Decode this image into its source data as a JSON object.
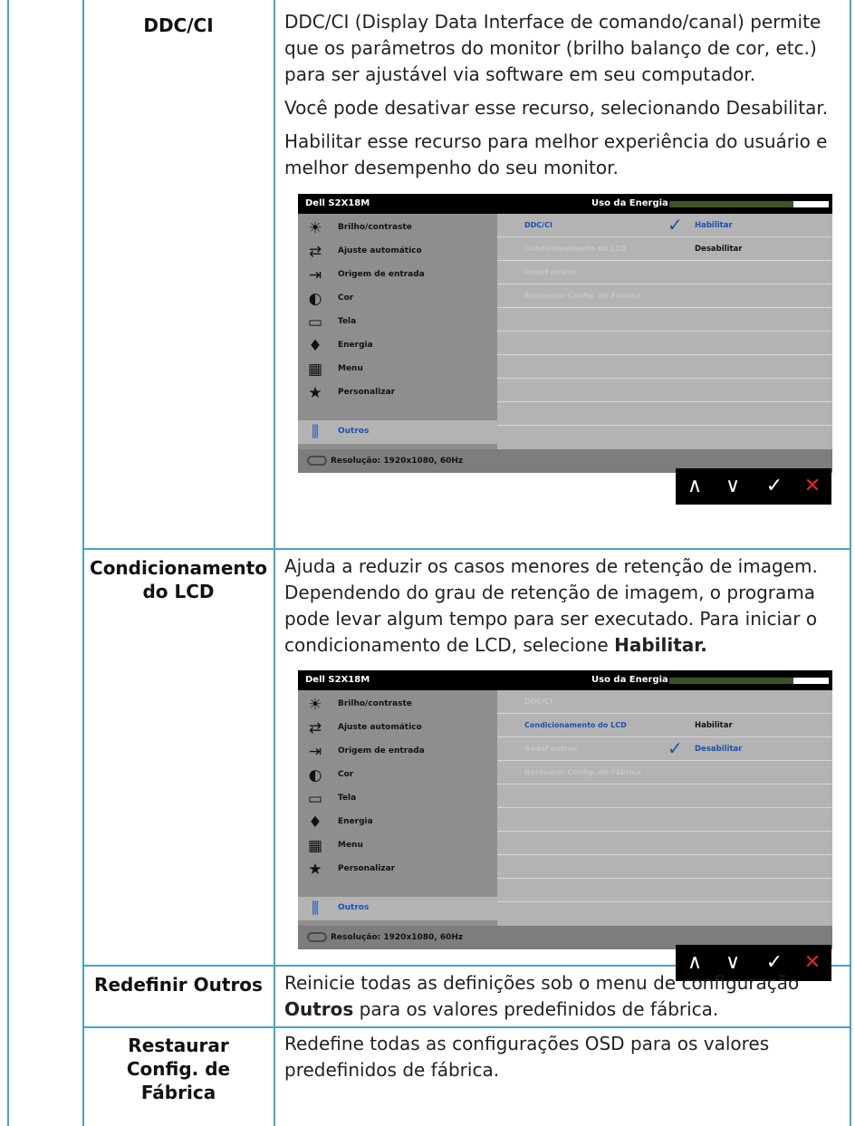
{
  "rows": [
    {
      "term": "DDC/CI",
      "paragraphs": [
        "DDC/CI (Display Data Interface de comando/canal) permite que os parâmetros do monitor (brilho balanço de cor, etc.) para ser ajustável via software em seu computador.",
        "Você pode desativar esse recurso, selecionando Desabilitar.",
        "Habilitar esse recurso para melhor experiência do usuário e melhor desempenho do seu monitor."
      ]
    },
    {
      "term_line1": "Condicionamento",
      "term_line2": "do LCD",
      "text_before": "Ajuda a reduzir os casos menores de retenção de imagem. Dependendo do grau de retenção de imagem, o programa pode levar algum tempo para ser executado. Para iniciar o condicionamento de LCD, selecione ",
      "text_bold": "Habilitar.",
      "text_after": ""
    },
    {
      "term": "Redefinir Outros",
      "text_before": "Reinicie todas as definições sob o menu de configuração ",
      "text_bold": "Outros",
      "text_after": " para os valores predefinidos de fábrica."
    },
    {
      "term_line1": "Restaurar",
      "term_line2": "Config. de",
      "term_line3": "Fábrica",
      "text": "Redefine todas as configurações OSD para os valores predefinidos de fábrica."
    }
  ],
  "osd": {
    "model": "Dell S2X18M",
    "energy_label": "Uso da Energia",
    "energy_level": 0.78,
    "resolution": "Resolução: 1920x1080, 60Hz",
    "menu": [
      {
        "icon": "brightness-icon",
        "glyph": "☀",
        "label": "Brilho/contraste"
      },
      {
        "icon": "auto-adjust-icon",
        "glyph": "⇄",
        "label": "Ajuste automático"
      },
      {
        "icon": "input-source-icon",
        "glyph": "⇥",
        "label": "Origem de entrada"
      },
      {
        "icon": "color-icon",
        "glyph": "◐",
        "label": "Cor"
      },
      {
        "icon": "display-icon",
        "glyph": "▭",
        "label": "Tela"
      },
      {
        "icon": "energy-icon",
        "glyph": "♦",
        "label": "Energia"
      },
      {
        "icon": "menu-icon",
        "glyph": "▦",
        "label": "Menu"
      },
      {
        "icon": "star-icon",
        "glyph": "★",
        "label": "Personalizar"
      },
      {
        "icon": "others-icon",
        "glyph": "⫼",
        "label": "Outros"
      }
    ],
    "submenu": [
      "DDC/CI",
      "Condicionamento do LCD",
      "Redef outros",
      "Restaurar Config. de Fábrica"
    ],
    "enable": "Habilitar",
    "disable": "Desabilitar",
    "check_glyph": "✓"
  },
  "nav": {
    "up": "∧",
    "down": "∨",
    "ok": "✓",
    "close": "✕"
  }
}
